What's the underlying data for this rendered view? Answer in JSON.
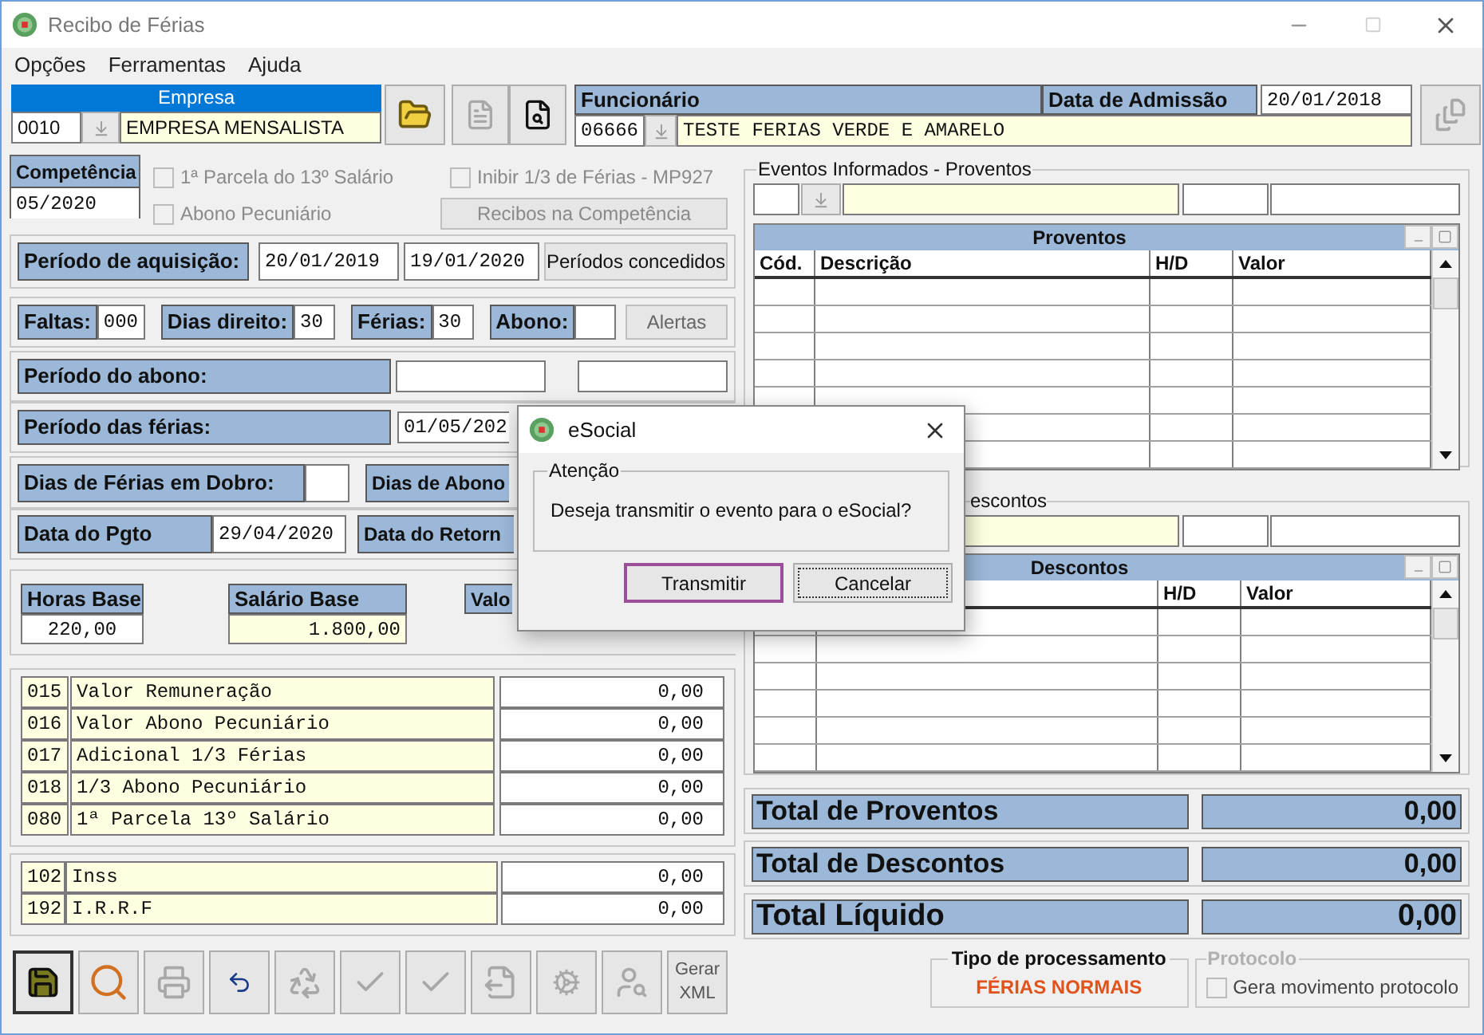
{
  "window": {
    "title": "Recibo de Férias"
  },
  "menu": [
    "Opções",
    "Ferramentas",
    "Ajuda"
  ],
  "empresa": {
    "label": "Empresa",
    "code": "0010",
    "name": "EMPRESA MENSALISTA"
  },
  "header_buttons": [
    {
      "kind": "open",
      "disabled": false
    },
    {
      "kind": "document",
      "disabled": true
    },
    {
      "kind": "find",
      "disabled": false
    }
  ],
  "funcionario": {
    "label": "Funcionário",
    "code": "06666",
    "name": "TESTE FERIAS VERDE E AMARELO",
    "admission_label": "Data de Admissão",
    "admission_date": "20/01/2018"
  },
  "competencia": {
    "label": "Competência",
    "value": "05/2020"
  },
  "options": [
    {
      "label": "1ª Parcela do 13º Salário",
      "checked": false,
      "disabled": true
    },
    {
      "label": "Abono Pecuniário",
      "checked": false,
      "disabled": true
    },
    {
      "label": "Inibir 1/3 de Férias - MP927",
      "checked": false,
      "disabled": true
    }
  ],
  "recibos_button": {
    "label": "Recibos na Competência",
    "disabled": true
  },
  "aquisicao": {
    "label": "Período de aquisição:",
    "start": "20/01/2019",
    "end": "19/01/2020",
    "button": "Períodos concedidos"
  },
  "counts": [
    {
      "label": "Faltas:",
      "value": "000"
    },
    {
      "label": "Dias direito:",
      "value": "30"
    },
    {
      "label": "Férias:",
      "value": "30"
    },
    {
      "label": "Abono:"
    }
  ],
  "alertas_button": "Alertas",
  "abono_period": {
    "label": "Período do abono:"
  },
  "ferias_period": {
    "label": "Período das férias:",
    "start": "01/05/202"
  },
  "dobro": {
    "label": "Dias de Férias em Dobro:",
    "abono_label": "Dias de Abono"
  },
  "pagamento": {
    "label": "Data do Pgto",
    "date": "29/04/2020",
    "retorno_label": "Data do Retorn"
  },
  "bases": {
    "horas_label": "Horas Base",
    "horas": "220,00",
    "salario_label": "Salário Base",
    "salario": "1.800,00",
    "valor_label": "Valo"
  },
  "proventos_lines": [
    {
      "code": "015",
      "description": "Valor Remuneração",
      "value": "0,00"
    },
    {
      "code": "016",
      "description": "Valor Abono Pecuniário",
      "value": "0,00"
    },
    {
      "code": "017",
      "description": "Adicional 1/3 Férias",
      "value": "0,00"
    },
    {
      "code": "018",
      "description": "1/3 Abono Pecuniário",
      "value": "0,00"
    },
    {
      "code": "080",
      "description": "1ª Parcela 13º Salário",
      "value": "0,00"
    }
  ],
  "descontos_lines": [
    {
      "code": "102",
      "description": "Inss",
      "value": "0,00"
    },
    {
      "code": "192",
      "description": "I.R.R.F",
      "value": "0,00"
    }
  ],
  "toolbar": [
    {
      "kind": "save",
      "disabled": false
    },
    {
      "kind": "search",
      "disabled": false
    },
    {
      "kind": "print",
      "disabled": true
    },
    {
      "kind": "undo",
      "disabled": false
    },
    {
      "kind": "recycle",
      "disabled": true
    },
    {
      "kind": "check",
      "disabled": true
    },
    {
      "kind": "check",
      "disabled": true
    },
    {
      "kind": "export",
      "disabled": true
    },
    {
      "kind": "gear",
      "disabled": true
    },
    {
      "kind": "person-search",
      "disabled": true
    },
    {
      "kind": "xml",
      "label": "Gerar XML",
      "disabled": false
    }
  ],
  "eventos_proventos": {
    "legend": "Eventos Informados - Proventos",
    "grid_title": "Proventos",
    "columns": [
      "Cód.",
      "Descrição",
      "H/D",
      "Valor"
    ]
  },
  "eventos_descontos": {
    "legend": "escontos",
    "grid_title": "Descontos",
    "columns": [
      "H/D",
      "Valor"
    ]
  },
  "totals": [
    {
      "label": "Total de Proventos",
      "value": "0,00"
    },
    {
      "label": "Total de Descontos",
      "value": "0,00"
    },
    {
      "label": "Total Líquido",
      "value": "0,00"
    }
  ],
  "processing": {
    "legend": "Tipo de processamento",
    "value": "FÉRIAS NORMAIS"
  },
  "protocolo": {
    "legend": "Protocolo",
    "checkbox_label": "Gera movimento protocolo",
    "checked": false,
    "disabled": true
  },
  "dialog": {
    "title": "eSocial",
    "group": "Atenção",
    "message": "Deseja transmitir o evento para o eSocial?",
    "buttons": [
      {
        "label": "Transmitir",
        "highlighted": true,
        "focused": false
      },
      {
        "label": "Cancelar",
        "highlighted": false,
        "focused": true
      }
    ]
  }
}
